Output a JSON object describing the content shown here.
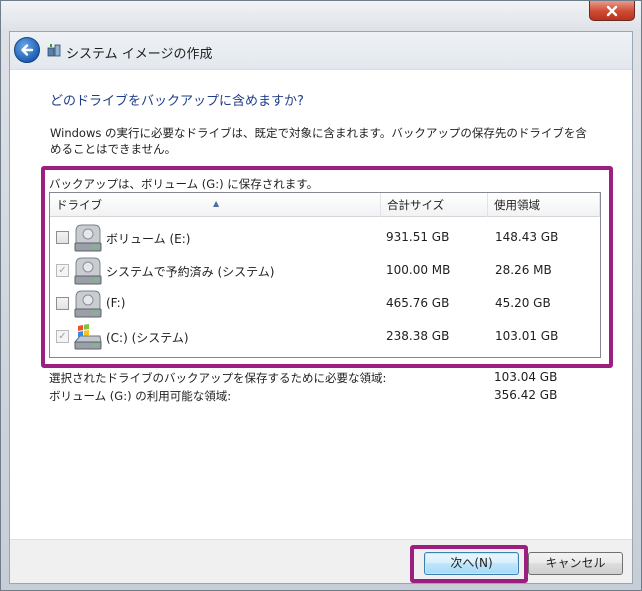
{
  "window": {
    "title": "システム イメージの作成",
    "close_icon": "close-icon"
  },
  "instruction": "どのドライブをバックアップに含めますか?",
  "description": "Windows の実行に必要なドライブは、既定で対象に含まれます。バックアップの保存先のドライブを含めることはできません。",
  "save_note": "バックアップは、ボリューム (G:) に保存されます。",
  "columns": {
    "drive": "ドライブ",
    "total": "合計サイズ",
    "used": "使用領域"
  },
  "drives": [
    {
      "name": "ボリューム (E:)",
      "total": "931.51 GB",
      "used": "148.43 GB",
      "checked": false,
      "disabled": false,
      "icon": "hard-drive-icon"
    },
    {
      "name": "システムで予約済み (システム)",
      "total": "100.00 MB",
      "used": "28.26 MB",
      "checked": true,
      "disabled": true,
      "icon": "hard-drive-icon"
    },
    {
      "name": "(F:)",
      "total": "465.76 GB",
      "used": "45.20 GB",
      "checked": false,
      "disabled": false,
      "icon": "hard-drive-icon"
    },
    {
      "name": "(C:) (システム)",
      "total": "238.38 GB",
      "used": "103.01 GB",
      "checked": true,
      "disabled": true,
      "icon": "windows-drive-icon"
    }
  ],
  "summary": {
    "required_label": "選択されたドライブのバックアップを保存するために必要な領域:",
    "required_value": "103.04 GB",
    "available_label": "ボリューム (G:) の利用可能な領域:",
    "available_value": "356.42 GB"
  },
  "buttons": {
    "next": "次へ(N)",
    "cancel": "キャンセル"
  },
  "colors": {
    "highlight": "#9c1f7f",
    "instruction": "#1e3c87"
  }
}
